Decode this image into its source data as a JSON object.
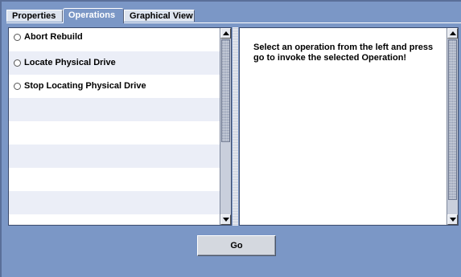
{
  "tabs": [
    {
      "label": "Properties"
    },
    {
      "label": "Operations"
    },
    {
      "label": "Graphical View"
    }
  ],
  "active_tab": "Operations",
  "operations": {
    "options": [
      {
        "label": "Abort Rebuild",
        "selected": false
      },
      {
        "label": "Locate Physical Drive",
        "selected": false
      },
      {
        "label": "Stop Locating Physical Drive",
        "selected": false
      }
    ]
  },
  "message": {
    "text": "Select an operation from the left and press go to invoke the selected Operation!"
  },
  "actions": {
    "go_label": "Go"
  },
  "colors": {
    "background": "#7b97c6",
    "panel": "#ffffff",
    "row_alt": "#ebeef7"
  }
}
